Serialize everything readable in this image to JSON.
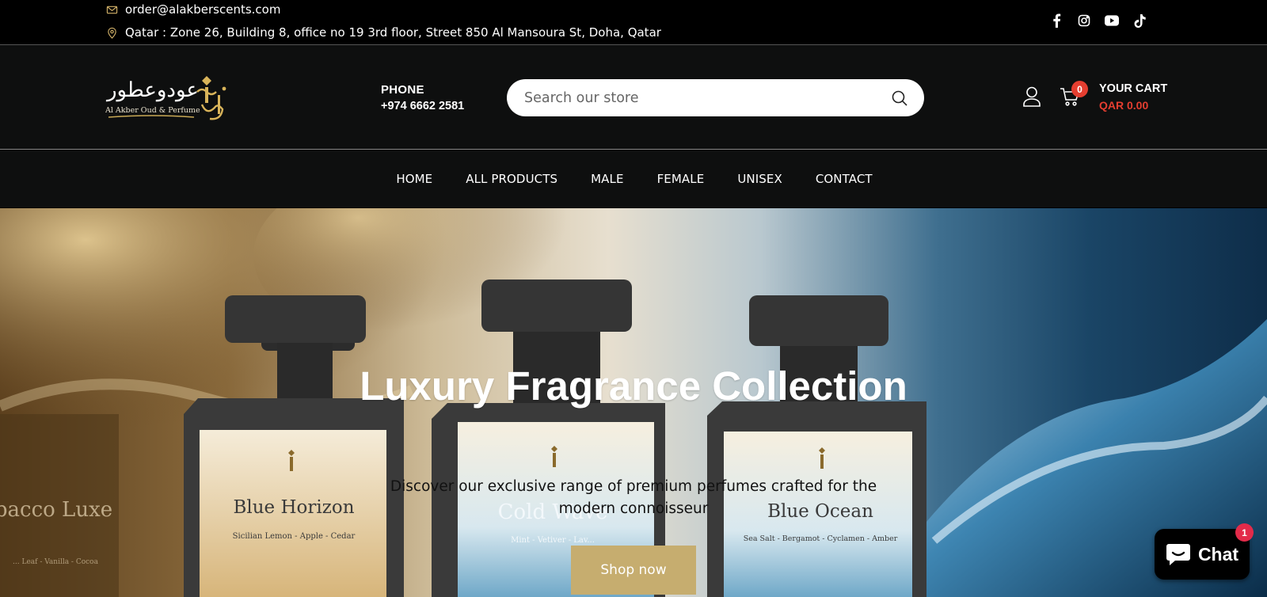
{
  "topbar": {
    "email": "order@alakberscents.com",
    "address": "Qatar : Zone 26, Building 8, office no 19 3rd floor, Street 850 Al Mansoura St, Doha, Qatar",
    "socials": [
      "facebook-icon",
      "instagram-icon",
      "youtube-icon",
      "tiktok-icon"
    ]
  },
  "header": {
    "logo": {
      "arabic": "عودوعطور",
      "tagline": "Al Akber Oud & Perfume"
    },
    "phone_label": "PHONE",
    "phone_number": "+974 6662 2581",
    "search_placeholder": "Search our store",
    "cart_count": "0",
    "cart_label": "YOUR CART",
    "cart_total": "QAR 0.00"
  },
  "nav": {
    "items": [
      {
        "label": "HOME"
      },
      {
        "label": "ALL PRODUCTS"
      },
      {
        "label": "MALE"
      },
      {
        "label": "FEMALE"
      },
      {
        "label": "UNISEX"
      },
      {
        "label": "CONTACT"
      }
    ]
  },
  "hero": {
    "title": "Luxury Fragrance Collection",
    "subtitle": "Discover our exclusive range of premium perfumes crafted for the modern connoisseur",
    "cta": "Shop now",
    "bottles": [
      {
        "name": "Tobacco Luxe",
        "notes": "... Leaf - Vanilla - Cocoa"
      },
      {
        "name": "Blue Horizon",
        "notes": "Sicilian Lemon - Apple - Cedar"
      },
      {
        "name": "Cold Wave",
        "notes": "Mint - Vetiver - Lav..."
      },
      {
        "name": "Blue Ocean",
        "notes": "Sea Salt - Bergamot - Cyclamen - Amber"
      }
    ]
  },
  "chat": {
    "label": "Chat",
    "badge": "1"
  },
  "colors": {
    "accent_red": "#e53e30",
    "gold": "#c6ad6f",
    "dark": "#0e0f0f"
  }
}
